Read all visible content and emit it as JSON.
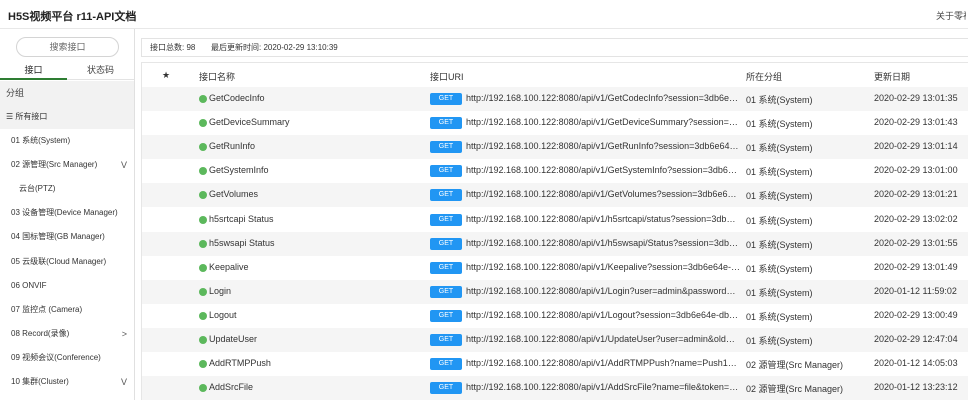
{
  "header": {
    "title": "H5S视频平台 r11-API文档",
    "about": "关于零视"
  },
  "sidebar": {
    "search_placeholder": "搜索接口",
    "tabs": [
      "接口",
      "状态码"
    ],
    "section_label": "分组",
    "all_label": "☰ 所有接口",
    "items": [
      {
        "label": "01 系统(System)",
        "chevron": ""
      },
      {
        "label": "02 源管理(Src Manager)",
        "chevron": "V"
      },
      {
        "label": "云台(PTZ)",
        "chevron": ""
      },
      {
        "label": "03 设备管理(Device Manager)",
        "chevron": ""
      },
      {
        "label": "04 国标管理(GB Manager)",
        "chevron": ""
      },
      {
        "label": "05 云级联(Cloud Manager)",
        "chevron": ""
      },
      {
        "label": "06 ONVIF",
        "chevron": ""
      },
      {
        "label": "07 监控点 (Camera)",
        "chevron": ""
      },
      {
        "label": "08 Record(录像)",
        "chevron": ">"
      },
      {
        "label": "09 视频会议(Conference)",
        "chevron": ""
      },
      {
        "label": "10 集群(Cluster)",
        "chevron": "V"
      }
    ]
  },
  "info": {
    "total": "接口总数:   98",
    "updated": "最后更新时间:   2020-02-29 13:10:39"
  },
  "table": {
    "headers": {
      "star": "★",
      "name": "接口名称",
      "uri": "接口URI",
      "group": "所在分组",
      "date": "更新日期"
    },
    "rows": [
      {
        "name": "GetCodecInfo",
        "method": "GET",
        "uri": "http://192.168.100.122:8080/api/v1/GetCodecInfo?session=3db6e…",
        "group": "01 系统(System)",
        "date": "2020-02-29 13:01:35"
      },
      {
        "name": "GetDeviceSummary",
        "method": "GET",
        "uri": "http://192.168.100.122:8080/api/v1/GetDeviceSummary?session=…",
        "group": "01 系统(System)",
        "date": "2020-02-29 13:01:43"
      },
      {
        "name": "GetRunInfo",
        "method": "GET",
        "uri": "http://192.168.100.122:8080/api/v1/GetRunInfo?session=3db6e64…",
        "group": "01 系统(System)",
        "date": "2020-02-29 13:01:14"
      },
      {
        "name": "GetSystemInfo",
        "method": "GET",
        "uri": "http://192.168.100.122:8080/api/v1/GetSystemInfo?session=3db6…",
        "group": "01 系统(System)",
        "date": "2020-02-29 13:01:00"
      },
      {
        "name": "GetVolumes",
        "method": "GET",
        "uri": "http://192.168.100.122:8080/api/v1/GetVolumes?session=3db6e6…",
        "group": "01 系统(System)",
        "date": "2020-02-29 13:01:21"
      },
      {
        "name": "h5srtcapi Status",
        "method": "GET",
        "uri": "http://192.168.100.122:8080/api/v1/h5srtcapi/status?session=3db…",
        "group": "01 系统(System)",
        "date": "2020-02-29 13:02:02"
      },
      {
        "name": "h5swsapi Status",
        "method": "GET",
        "uri": "http://192.168.100.122:8080/api/v1/h5swsapi/Status?session=3db…",
        "group": "01 系统(System)",
        "date": "2020-02-29 13:01:55"
      },
      {
        "name": "Keepalive",
        "method": "GET",
        "uri": "http://192.168.100.122:8080/api/v1/Keepalive?session=3db6e64e-…",
        "group": "01 系统(System)",
        "date": "2020-02-29 13:01:49"
      },
      {
        "name": "Login",
        "method": "GET",
        "uri": "http://192.168.100.122:8080/api/v1/Login?user=admin&password…",
        "group": "01 系统(System)",
        "date": "2020-01-12 11:59:02"
      },
      {
        "name": "Logout",
        "method": "GET",
        "uri": "http://192.168.100.122:8080/api/v1/Logout?session=3db6e64e-db…",
        "group": "01 系统(System)",
        "date": "2020-02-29 13:00:49"
      },
      {
        "name": "UpdateUser",
        "method": "GET",
        "uri": "http://192.168.100.122:8080/api/v1/UpdateUser?user=admin&old…",
        "group": "01 系统(System)",
        "date": "2020-02-29 12:47:04"
      },
      {
        "name": "AddRTMPPush",
        "method": "GET",
        "uri": "http://192.168.100.122:8080/api/v1/AddRTMPPush?name=Push1…",
        "group": "02 源管理(Src Manager)",
        "date": "2020-01-12 14:05:03"
      },
      {
        "name": "AddSrcFile",
        "method": "GET",
        "uri": "http://192.168.100.122:8080/api/v1/AddSrcFile?name=file&token=…",
        "group": "02 源管理(Src Manager)",
        "date": "2020-01-12 13:23:12"
      }
    ]
  }
}
